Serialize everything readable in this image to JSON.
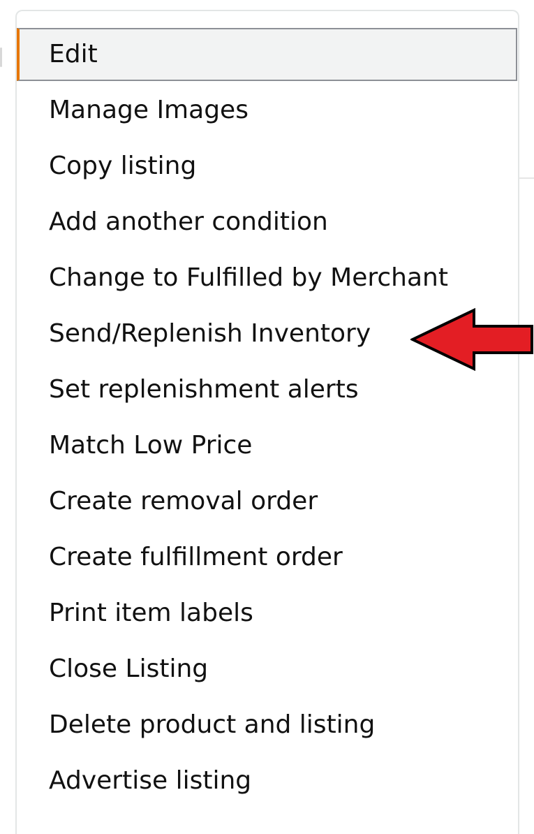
{
  "menu": {
    "items": [
      {
        "label": "Edit",
        "selected": true
      },
      {
        "label": "Manage Images"
      },
      {
        "label": "Copy listing"
      },
      {
        "label": "Add another condition"
      },
      {
        "label": "Change to Fulfilled by Merchant"
      },
      {
        "label": "Send/Replenish Inventory"
      },
      {
        "label": "Set replenishment alerts"
      },
      {
        "label": "Match Low Price"
      },
      {
        "label": "Create removal order"
      },
      {
        "label": "Create fulfillment order"
      },
      {
        "label": "Print item labels"
      },
      {
        "label": "Close Listing"
      },
      {
        "label": "Delete product and listing"
      },
      {
        "label": "Advertise listing"
      }
    ]
  },
  "colors": {
    "arrow": "#e31e24",
    "selected_accent": "#e77600",
    "selected_background": "#f2f3f3",
    "text": "#111111"
  },
  "annotation": {
    "icon": "red-arrow-left-icon",
    "points_to": "Send/Replenish Inventory"
  }
}
